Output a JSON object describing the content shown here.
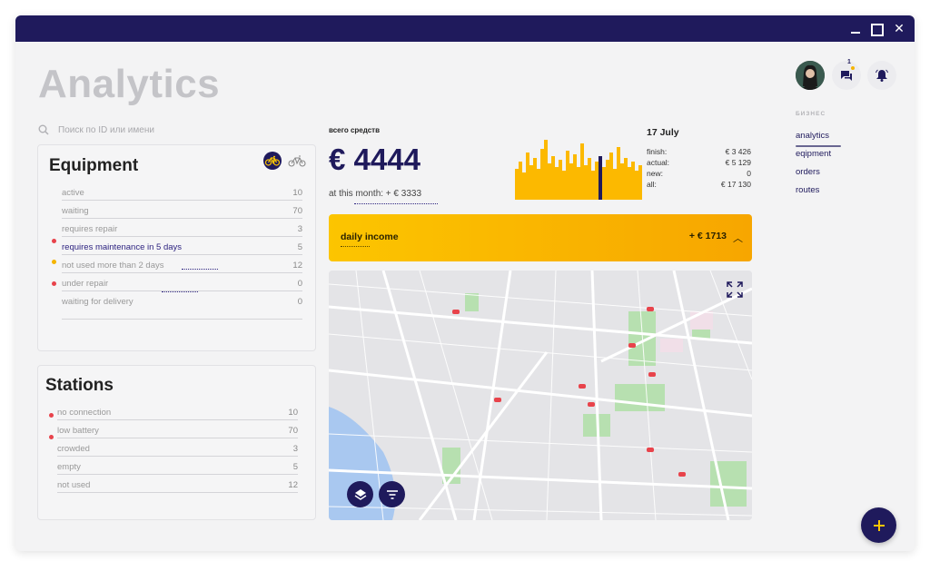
{
  "page": {
    "title": "Analytics"
  },
  "search": {
    "placeholder": "Поиск по ID или имени"
  },
  "equipment": {
    "title": "Equipment",
    "rows": [
      {
        "label": "active",
        "value": "10"
      },
      {
        "label": "waiting",
        "value": "70"
      },
      {
        "label": "requires repair",
        "value": "3"
      },
      {
        "label": "requires maintenance in 5 days",
        "value": "5"
      },
      {
        "label": "not used more than 2 days",
        "value": "12"
      },
      {
        "label": "under repair",
        "value": "0"
      },
      {
        "label": "waiting for delivery",
        "value": "0"
      }
    ]
  },
  "stations": {
    "title": "Stations",
    "rows": [
      {
        "label": "no connection",
        "value": "10"
      },
      {
        "label": "low battery",
        "value": "70"
      },
      {
        "label": "crowded",
        "value": "3"
      },
      {
        "label": "empty",
        "value": "5"
      },
      {
        "label": "not used",
        "value": "12"
      }
    ]
  },
  "funds": {
    "caption": "всего средств",
    "amount": "€ 4444",
    "month_text": "at this month: + € 3333"
  },
  "day_stats": {
    "date": "17 July",
    "rows": [
      {
        "label": "finish:",
        "value": "€ 3 426"
      },
      {
        "label": "actual:",
        "value": "€ 5 129"
      },
      {
        "label": "new:",
        "value": "0"
      },
      {
        "label": "all:",
        "value": "€ 17 130"
      }
    ]
  },
  "income": {
    "label": "daily income",
    "value": "+ € 1713"
  },
  "notifications": {
    "messages_count": "1"
  },
  "nav": {
    "section": "БИЗНЕС",
    "items": [
      "analytics",
      "eqipment",
      "orders",
      "routes"
    ]
  },
  "colors": {
    "primary": "#1f1a5c",
    "accent": "#fcc500",
    "alert": "#e8434b",
    "warn": "#f5b400"
  },
  "icons": {
    "search": "search-icon",
    "bike_active": "bicycle-icon",
    "bike_inactive": "scooter-icon",
    "layers": "layers-icon",
    "filter": "filter-icon",
    "expand": "expand-icon",
    "chat": "chat-icon",
    "bell": "bell-icon",
    "add": "plus-icon"
  }
}
